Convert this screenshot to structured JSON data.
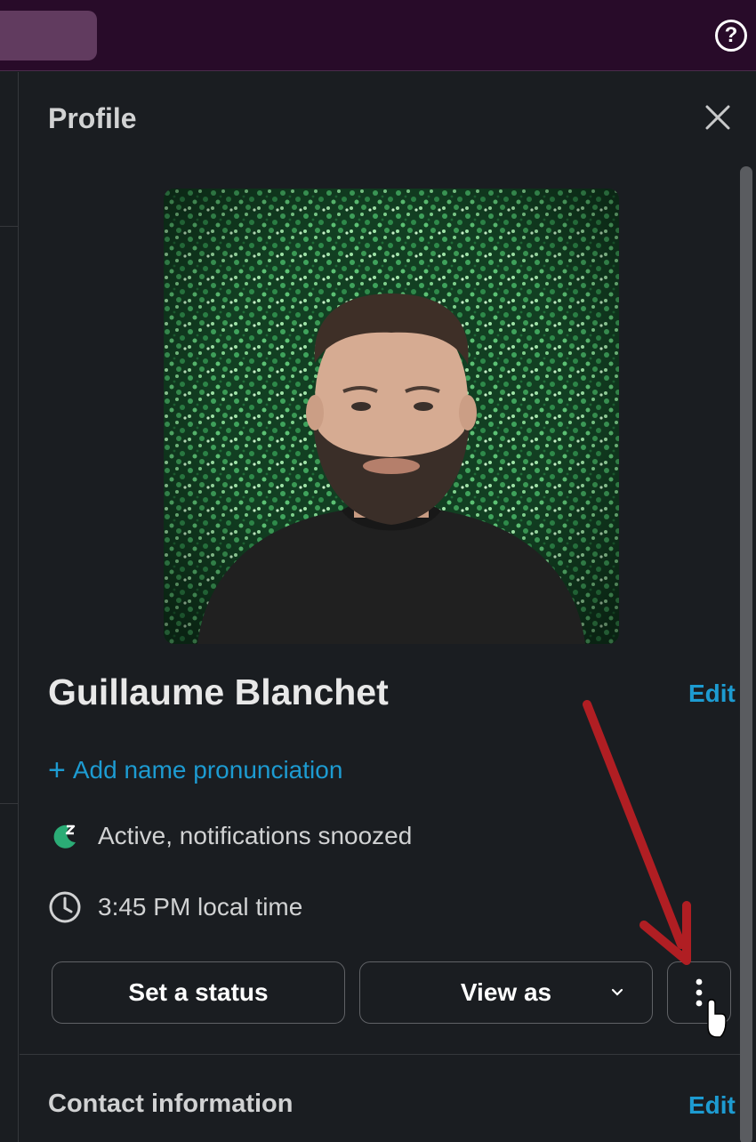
{
  "header": {
    "help_icon": "question-circle-icon",
    "help_label": "?"
  },
  "panel": {
    "title": "Profile",
    "close_icon": "close-icon"
  },
  "profile": {
    "name": "Guillaume Blanchet",
    "edit_label": "Edit",
    "pronunciation_plus": "+",
    "pronunciation_label": "Add name pronunciation",
    "status_text": "Active, notifications snoozed",
    "status_icon": "snooze-icon",
    "local_time": "3:45 PM local time",
    "time_icon": "clock-icon"
  },
  "actions": {
    "set_status": "Set a status",
    "view_as": "View as",
    "more_icon": "vertical-ellipsis-icon"
  },
  "contact": {
    "title": "Contact information",
    "edit_label": "Edit"
  },
  "colors": {
    "accent": "#1d9bd1",
    "topbar": "#280b29",
    "panel": "#1a1d21",
    "snooze": "#2bac76",
    "annotation_arrow": "#b01e23"
  }
}
